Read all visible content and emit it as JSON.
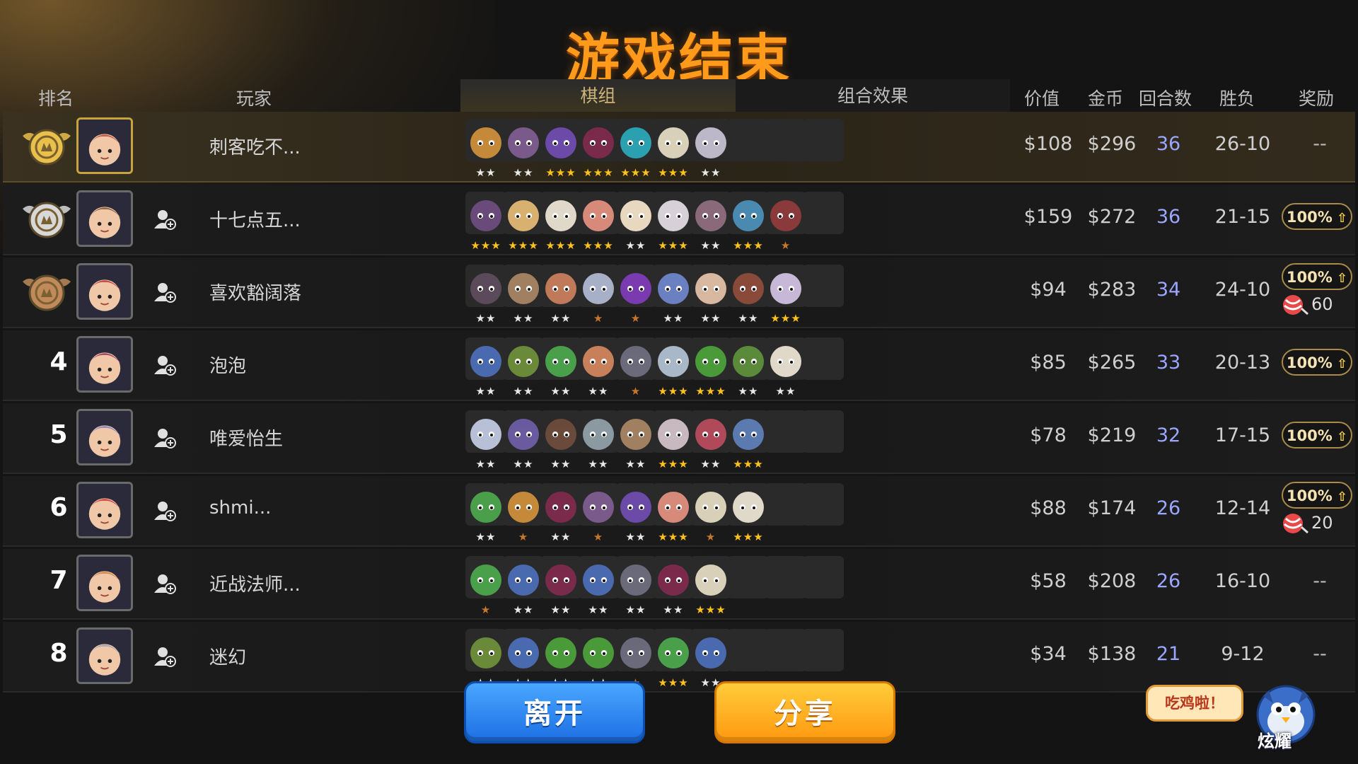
{
  "screen_title": "游戏结束",
  "columns": {
    "rank": "排名",
    "player": "玩家",
    "lineup": "棋组",
    "synergy": "组合效果",
    "value": "价值",
    "gold": "金币",
    "rounds": "回合数",
    "win_loss": "胜负",
    "reward": "奖励"
  },
  "players": [
    {
      "rank": "1",
      "name": "刺客吃不...",
      "value": "$108",
      "gold": "$296",
      "rounds": "36",
      "win_loss": "26-10",
      "reward": "--",
      "badge": "",
      "candy": ""
    },
    {
      "rank": "2",
      "name": "十七点五...",
      "value": "$159",
      "gold": "$272",
      "rounds": "36",
      "win_loss": "21-15",
      "reward": "",
      "badge": "100%",
      "candy": ""
    },
    {
      "rank": "3",
      "name": "喜欢豁阔落",
      "value": "$94",
      "gold": "$283",
      "rounds": "34",
      "win_loss": "24-10",
      "reward": "",
      "badge": "100%",
      "candy": "60"
    },
    {
      "rank": "4",
      "name": "泡泡",
      "value": "$85",
      "gold": "$265",
      "rounds": "33",
      "win_loss": "20-13",
      "reward": "",
      "badge": "100%",
      "candy": ""
    },
    {
      "rank": "5",
      "name": "唯爱怡生",
      "value": "$78",
      "gold": "$219",
      "rounds": "32",
      "win_loss": "17-15",
      "reward": "",
      "badge": "100%",
      "candy": ""
    },
    {
      "rank": "6",
      "name": "shmi...",
      "value": "$88",
      "gold": "$174",
      "rounds": "26",
      "win_loss": "12-14",
      "reward": "",
      "badge": "100%",
      "candy": "20"
    },
    {
      "rank": "7",
      "name": "近战法师...",
      "value": "$58",
      "gold": "$208",
      "rounds": "26",
      "win_loss": "16-10",
      "reward": "--",
      "badge": "",
      "candy": ""
    },
    {
      "rank": "8",
      "name": "迷幻",
      "value": "$34",
      "gold": "$138",
      "rounds": "21",
      "win_loss": "9-12",
      "reward": "--",
      "badge": "",
      "candy": ""
    }
  ],
  "lineups": [
    [
      [
        2,
        "#c48a3a"
      ],
      [
        2,
        "#7a5a8a"
      ],
      [
        3,
        "#6b4aa8"
      ],
      [
        3,
        "#7a2a4a"
      ],
      [
        3,
        "#2aa0b0"
      ],
      [
        3,
        "#d8d0b8"
      ],
      [
        2,
        "#bdb8c8"
      ],
      0,
      0,
      0
    ],
    [
      [
        3,
        "#6a4a7a"
      ],
      [
        3,
        "#d8b070"
      ],
      [
        3,
        "#e0d8c8"
      ],
      [
        3,
        "#d88a7a"
      ],
      [
        2,
        "#e8d8c0"
      ],
      [
        3,
        "#d8d0d8"
      ],
      [
        2,
        "#8a6a7a"
      ],
      [
        3,
        "#4a8ab0"
      ],
      [
        1,
        "#8a3a3a"
      ],
      0
    ],
    [
      [
        2,
        "#5a4a5a"
      ],
      [
        2,
        "#a08060"
      ],
      [
        2,
        "#c07a5a"
      ],
      [
        1,
        "#a8b0c8"
      ],
      [
        1,
        "#7a3ab0"
      ],
      [
        2,
        "#6a80c0"
      ],
      [
        2,
        "#d8b8a0"
      ],
      [
        2,
        "#8a4a3a"
      ],
      [
        3,
        "#c8b8d8"
      ],
      0
    ],
    [
      [
        2,
        "#4a6ab0"
      ],
      [
        2,
        "#6a8a3a"
      ],
      [
        2,
        "#4aa04a"
      ],
      [
        2,
        "#c8805a"
      ],
      [
        1,
        "#6a6a7a"
      ],
      [
        3,
        "#a8b8c8"
      ],
      [
        3,
        "#4a9a3a"
      ],
      [
        2,
        "#5a8a3a"
      ],
      [
        2,
        "#e0d8c8"
      ],
      0
    ],
    [
      [
        2,
        "#b8c0d8"
      ],
      [
        2,
        "#6a5aa0"
      ],
      [
        2,
        "#6a4a3a"
      ],
      [
        2,
        "#8a9aa0"
      ],
      [
        2,
        "#a08060"
      ],
      [
        3,
        "#c8b8c0"
      ],
      [
        2,
        "#b04a5a"
      ],
      [
        3,
        "#5a7ab0"
      ],
      0,
      0
    ],
    [
      [
        2,
        "#4aa04a"
      ],
      [
        1,
        "#c48a3a"
      ],
      [
        2,
        "#7a2a4a"
      ],
      [
        1,
        "#7a5a8a"
      ],
      [
        2,
        "#6b4aa8"
      ],
      [
        3,
        "#d88a7a"
      ],
      [
        1,
        "#d8d0b8"
      ],
      [
        3,
        "#e0d8c8"
      ],
      0,
      0
    ],
    [
      [
        1,
        "#4aa04a"
      ],
      [
        2,
        "#4a6ab0"
      ],
      [
        2,
        "#7a2a4a"
      ],
      [
        2,
        "#4a6ab0"
      ],
      [
        2,
        "#6a6a7a"
      ],
      [
        2,
        "#7a2a4a"
      ],
      [
        3,
        "#d8d0b8"
      ],
      0,
      0,
      0
    ],
    [
      [
        2,
        "#6a8a3a"
      ],
      [
        2,
        "#4a6ab0"
      ],
      [
        2,
        "#4a9a3a"
      ],
      [
        2,
        "#4a9a3a"
      ],
      [
        1,
        "#6a6a7a"
      ],
      [
        3,
        "#4aa04a"
      ],
      [
        2,
        "#4a6ab0"
      ],
      0,
      0,
      0
    ]
  ],
  "buttons": {
    "leave": "离开",
    "share": "分享"
  },
  "celebration": {
    "bubble": "吃鸡啦！",
    "mascot_label": "炫耀"
  }
}
